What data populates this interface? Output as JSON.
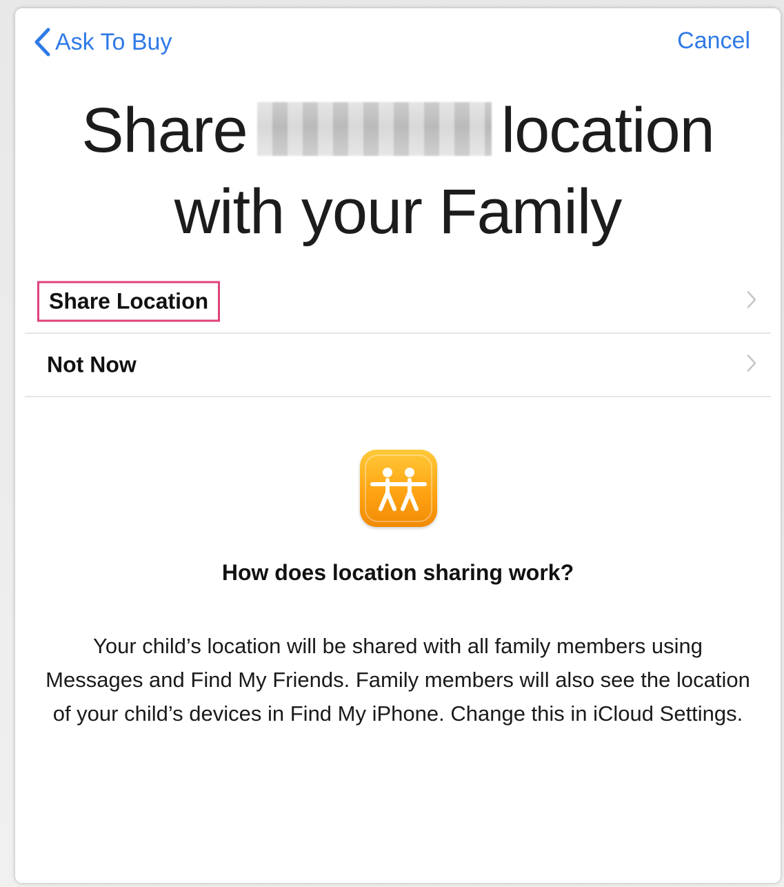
{
  "nav": {
    "back_label": "Ask To Buy",
    "cancel_label": "Cancel"
  },
  "headline": {
    "line1_prefix": "Share",
    "line1_suffix": "location",
    "line2": "with your Family"
  },
  "options": [
    {
      "label": "Share Location",
      "highlighted": true
    },
    {
      "label": "Not Now",
      "highlighted": false
    }
  ],
  "info": {
    "question": "How does location sharing work?",
    "body": "Your child’s location will be shared with all family members using Messages and Find My Friends. Family members will also see the location of your child’s devices in Find My iPhone. Change this in iCloud Settings."
  },
  "icons": {
    "back": "chevron-left-icon",
    "row_disclosure": "chevron-right-icon",
    "app": "find-my-friends-icon"
  },
  "colors": {
    "accent": "#2f7ae6",
    "highlight_border": "#e0427c",
    "app_icon": "#ffa412"
  }
}
